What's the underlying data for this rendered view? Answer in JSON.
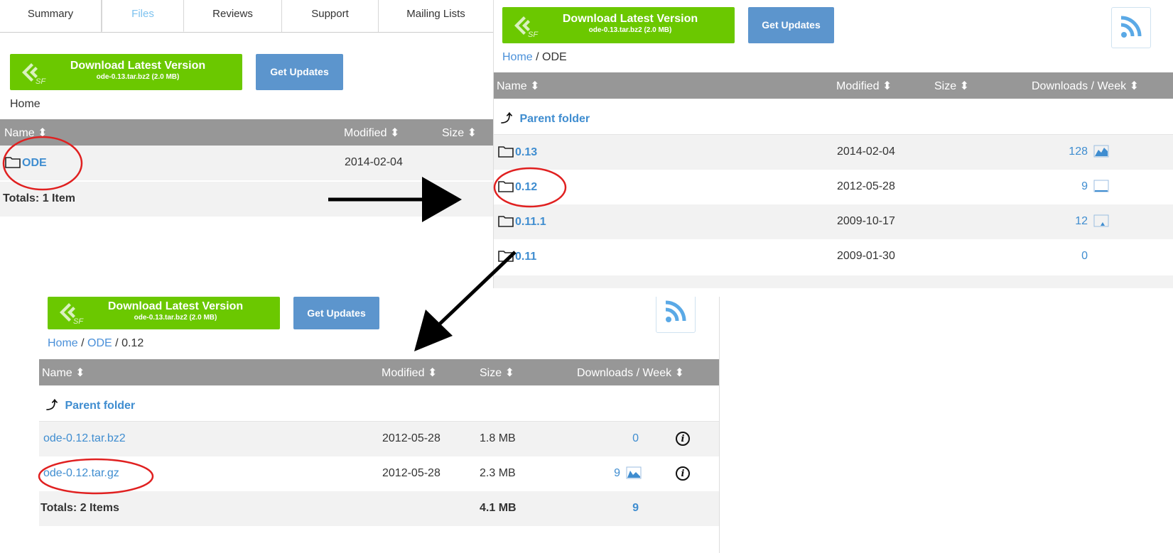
{
  "tabs": [
    "Summary",
    "Files",
    "Reviews",
    "Support",
    "Mailing Lists"
  ],
  "download": {
    "title": "Download Latest Version",
    "file": "ode-0.13.tar.bz2 (2.0 MB)"
  },
  "get_updates": "Get Updates",
  "columns": {
    "name": "Name",
    "modified": "Modified",
    "size": "Size",
    "downloads": "Downloads / Week"
  },
  "parent_folder": "Parent folder",
  "panel1": {
    "breadcrumb": [
      "Home"
    ],
    "rows": [
      {
        "name": "ODE",
        "modified": "2014-02-04"
      }
    ],
    "totals": "Totals: 1 Item"
  },
  "panel2": {
    "breadcrumb_home": "Home",
    "breadcrumb_sep": "/",
    "breadcrumb_current": "ODE",
    "rows": [
      {
        "name": "0.13",
        "modified": "2014-02-04",
        "downloads": "128"
      },
      {
        "name": "0.12",
        "modified": "2012-05-28",
        "downloads": "9"
      },
      {
        "name": "0.11.1",
        "modified": "2009-10-17",
        "downloads": "12"
      },
      {
        "name": "0.11",
        "modified": "2009-01-30",
        "downloads": "0"
      }
    ]
  },
  "panel3": {
    "breadcrumb_home": "Home",
    "breadcrumb_mid": "ODE",
    "breadcrumb_current": "0.12",
    "rows": [
      {
        "name": "ode-0.12.tar.bz2",
        "modified": "2012-05-28",
        "size": "1.8 MB",
        "downloads": "0"
      },
      {
        "name": "ode-0.12.tar.gz",
        "modified": "2012-05-28",
        "size": "2.3 MB",
        "downloads": "9"
      }
    ],
    "totals": "Totals: 2 Items",
    "totals_size": "4.1 MB",
    "totals_downloads": "9"
  },
  "colors": {
    "green": "#6bc800",
    "blue": "#5c95cd",
    "header": "#979797",
    "link": "#3f8dd0",
    "annotation": "#e02020"
  },
  "icons": [
    "sf-logo-icon",
    "rss-icon",
    "folder-icon",
    "parent-arrow-icon",
    "sort-icon",
    "chart-icon",
    "info-icon"
  ]
}
